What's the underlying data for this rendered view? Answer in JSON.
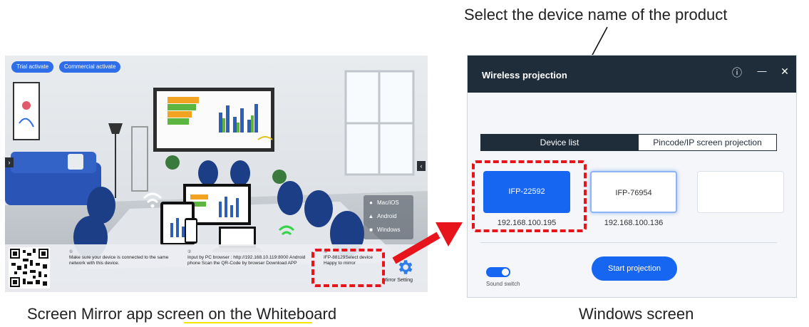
{
  "annotation": {
    "callout": "Select the device name of the product"
  },
  "captions": {
    "left": "Screen Mirror app screen on the Whiteboard",
    "right": "Windows screen"
  },
  "mirror_app": {
    "buttons": {
      "trial": "Trial activate",
      "commercial": "Commercial activate"
    },
    "platforms": [
      {
        "label": "Mac/iOS",
        "icon": "apple-icon"
      },
      {
        "label": "Android",
        "icon": "android-icon"
      },
      {
        "label": "Windows",
        "icon": "windows-icon"
      }
    ],
    "info": [
      {
        "num": "①",
        "text": "Make sure your device is connected to the same network with this device."
      },
      {
        "num": "②",
        "text": "Input by PC browser : http://192.168.10.119:8000 Android phone Scan the QR-Code by browser Download APP"
      },
      {
        "num": "③",
        "text": "IFP-88129Select device Happy to mirror"
      }
    ],
    "settings_label": "Mirror Setting"
  },
  "windows_app": {
    "title": "Wireless projection",
    "title_buttons": {
      "info": "ⓘ",
      "minimize": "—",
      "close": "✕"
    },
    "tabs": {
      "device_list": "Device list",
      "pincode": "Pincode/IP screen projection"
    },
    "devices": [
      {
        "name": "IFP-22592",
        "ip": "192.168.100.195",
        "selected": true
      },
      {
        "name": "IFP-76954",
        "ip": "192.168.100.136",
        "selected": false
      },
      {
        "name": "",
        "ip": "",
        "selected": false
      }
    ],
    "start_button": "Start projection",
    "sound_switch": {
      "label": "Sound switch",
      "on": true
    }
  },
  "colors": {
    "accent": "#1766f2",
    "title_bar": "#1f2d3a",
    "highlight": "#e8141b"
  }
}
